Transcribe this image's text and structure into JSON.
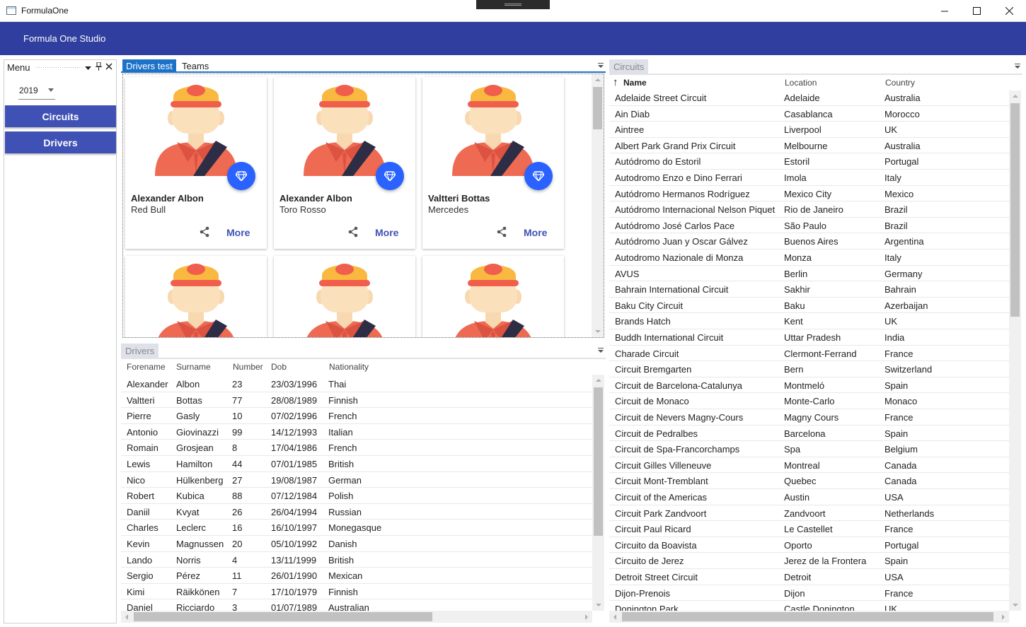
{
  "window": {
    "title": "FormulaOne",
    "minimize": "—",
    "maximize": "☐",
    "close": "✕"
  },
  "app": {
    "title": "Formula One Studio"
  },
  "menu": {
    "title": "Menu",
    "year": "2019",
    "buttons": [
      {
        "label": "Circuits"
      },
      {
        "label": "Drivers"
      }
    ]
  },
  "tabs": [
    {
      "label": "Drivers test"
    },
    {
      "label": "Teams"
    }
  ],
  "cards": [
    {
      "name": "Alexander Albon",
      "team": "Red Bull",
      "more": "More"
    },
    {
      "name": "Alexander Albon",
      "team": "Toro Rosso",
      "more": "More"
    },
    {
      "name": "Valtteri Bottas",
      "team": "Mercedes",
      "more": "More"
    },
    {
      "name": "",
      "team": "",
      "more": ""
    },
    {
      "name": "",
      "team": "",
      "more": ""
    },
    {
      "name": "",
      "team": "",
      "more": ""
    }
  ],
  "drivers_panel": {
    "title": "Drivers",
    "columns": [
      "Forename",
      "Surname",
      "Number",
      "Dob",
      "Nationality"
    ],
    "rows": [
      [
        "Alexander",
        "Albon",
        "23",
        "23/03/1996",
        "Thai"
      ],
      [
        "Valtteri",
        "Bottas",
        "77",
        "28/08/1989",
        "Finnish"
      ],
      [
        "Pierre",
        "Gasly",
        "10",
        "07/02/1996",
        "French"
      ],
      [
        "Antonio",
        "Giovinazzi",
        "99",
        "14/12/1993",
        "Italian"
      ],
      [
        "Romain",
        "Grosjean",
        "8",
        "17/04/1986",
        "French"
      ],
      [
        "Lewis",
        "Hamilton",
        "44",
        "07/01/1985",
        "British"
      ],
      [
        "Nico",
        "Hülkenberg",
        "27",
        "19/08/1987",
        "German"
      ],
      [
        "Robert",
        "Kubica",
        "88",
        "07/12/1984",
        "Polish"
      ],
      [
        "Daniil",
        "Kvyat",
        "26",
        "26/04/1994",
        "Russian"
      ],
      [
        "Charles",
        "Leclerc",
        "16",
        "16/10/1997",
        "Monegasque"
      ],
      [
        "Kevin",
        "Magnussen",
        "20",
        "05/10/1992",
        "Danish"
      ],
      [
        "Lando",
        "Norris",
        "4",
        "13/11/1999",
        "British"
      ],
      [
        "Sergio",
        "Pérez",
        "11",
        "26/01/1990",
        "Mexican"
      ],
      [
        "Kimi",
        "Räikkönen",
        "7",
        "17/10/1979",
        "Finnish"
      ],
      [
        "Daniel",
        "Ricciardo",
        "3",
        "01/07/1989",
        "Australian"
      ]
    ]
  },
  "circuits_panel": {
    "title": "Circuits",
    "sort_icon": "↑",
    "columns": [
      "Name",
      "Location",
      "Country"
    ],
    "rows": [
      [
        "Adelaide Street Circuit",
        "Adelaide",
        "Australia"
      ],
      [
        "Ain Diab",
        "Casablanca",
        "Morocco"
      ],
      [
        "Aintree",
        "Liverpool",
        "UK"
      ],
      [
        "Albert Park Grand Prix Circuit",
        "Melbourne",
        "Australia"
      ],
      [
        "Autódromo do Estoril",
        "Estoril",
        "Portugal"
      ],
      [
        "Autodromo Enzo e Dino Ferrari",
        "Imola",
        "Italy"
      ],
      [
        "Autódromo Hermanos Rodríguez",
        "Mexico City",
        "Mexico"
      ],
      [
        "Autódromo Internacional Nelson Piquet",
        "Rio de Janeiro",
        "Brazil"
      ],
      [
        "Autódromo José Carlos Pace",
        "São Paulo",
        "Brazil"
      ],
      [
        "Autódromo Juan y Oscar Gálvez",
        "Buenos Aires",
        "Argentina"
      ],
      [
        "Autodromo Nazionale di Monza",
        "Monza",
        "Italy"
      ],
      [
        "AVUS",
        "Berlin",
        "Germany"
      ],
      [
        "Bahrain International Circuit",
        "Sakhir",
        "Bahrain"
      ],
      [
        "Baku City Circuit",
        "Baku",
        "Azerbaijan"
      ],
      [
        "Brands Hatch",
        "Kent",
        "UK"
      ],
      [
        "Buddh International Circuit",
        "Uttar Pradesh",
        "India"
      ],
      [
        "Charade Circuit",
        "Clermont-Ferrand",
        "France"
      ],
      [
        "Circuit Bremgarten",
        "Bern",
        "Switzerland"
      ],
      [
        "Circuit de Barcelona-Catalunya",
        "Montmeló",
        "Spain"
      ],
      [
        "Circuit de Monaco",
        "Monte-Carlo",
        "Monaco"
      ],
      [
        "Circuit de Nevers Magny-Cours",
        "Magny Cours",
        "France"
      ],
      [
        "Circuit de Pedralbes",
        "Barcelona",
        "Spain"
      ],
      [
        "Circuit de Spa-Francorchamps",
        "Spa",
        "Belgium"
      ],
      [
        "Circuit Gilles Villeneuve",
        "Montreal",
        "Canada"
      ],
      [
        "Circuit Mont-Tremblant",
        "Quebec",
        "Canada"
      ],
      [
        "Circuit of the Americas",
        "Austin",
        "USA"
      ],
      [
        "Circuit Park Zandvoort",
        "Zandvoort",
        "Netherlands"
      ],
      [
        "Circuit Paul Ricard",
        "Le Castellet",
        "France"
      ],
      [
        "Circuito da Boavista",
        "Oporto",
        "Portugal"
      ],
      [
        "Circuito de Jerez",
        "Jerez de la Frontera",
        "Spain"
      ],
      [
        "Detroit Street Circuit",
        "Detroit",
        "USA"
      ],
      [
        "Dijon-Prenois",
        "Dijon",
        "France"
      ],
      [
        "Donington Park",
        "Castle Donington",
        "UK"
      ]
    ]
  },
  "colors": {
    "accent": "#303f9f",
    "button": "#3f51b5",
    "fab": "#2962ff",
    "tab_active": "#1c72c9"
  },
  "icons": {
    "card_fab": "diamond-icon",
    "card_share": "share-icon"
  }
}
